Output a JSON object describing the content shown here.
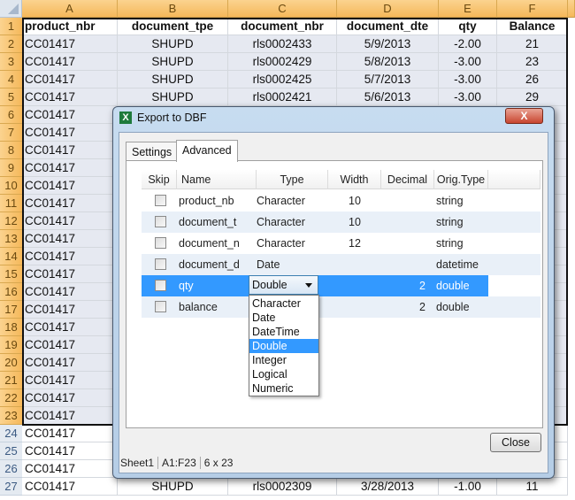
{
  "spreadsheet": {
    "columns": [
      "A",
      "B",
      "C",
      "D",
      "E",
      "F"
    ],
    "rows": [
      {
        "n": "1",
        "cells": [
          "product_nbr",
          "document_tpe",
          "document_nbr",
          "document_dte",
          "qty",
          "Balance"
        ]
      },
      {
        "n": "2",
        "cells": [
          "CC01417",
          "SHUPD",
          "rls0002433",
          "5/9/2013",
          "-2.00",
          "21"
        ]
      },
      {
        "n": "3",
        "cells": [
          "CC01417",
          "SHUPD",
          "rls0002429",
          "5/8/2013",
          "-3.00",
          "23"
        ]
      },
      {
        "n": "4",
        "cells": [
          "CC01417",
          "SHUPD",
          "rls0002425",
          "5/7/2013",
          "-3.00",
          "26"
        ]
      },
      {
        "n": "5",
        "cells": [
          "CC01417",
          "SHUPD",
          "rls0002421",
          "5/6/2013",
          "-3.00",
          "29"
        ]
      },
      {
        "n": "6",
        "cells": [
          "CC01417"
        ]
      },
      {
        "n": "7",
        "cells": [
          "CC01417"
        ]
      },
      {
        "n": "8",
        "cells": [
          "CC01417"
        ]
      },
      {
        "n": "9",
        "cells": [
          "CC01417"
        ]
      },
      {
        "n": "10",
        "cells": [
          "CC01417"
        ]
      },
      {
        "n": "11",
        "cells": [
          "CC01417"
        ]
      },
      {
        "n": "12",
        "cells": [
          "CC01417"
        ]
      },
      {
        "n": "13",
        "cells": [
          "CC01417"
        ]
      },
      {
        "n": "14",
        "cells": [
          "CC01417"
        ]
      },
      {
        "n": "15",
        "cells": [
          "CC01417"
        ]
      },
      {
        "n": "16",
        "cells": [
          "CC01417"
        ]
      },
      {
        "n": "17",
        "cells": [
          "CC01417"
        ]
      },
      {
        "n": "18",
        "cells": [
          "CC01417"
        ]
      },
      {
        "n": "19",
        "cells": [
          "CC01417"
        ]
      },
      {
        "n": "20",
        "cells": [
          "CC01417"
        ]
      },
      {
        "n": "21",
        "cells": [
          "CC01417"
        ]
      },
      {
        "n": "22",
        "cells": [
          "CC01417"
        ]
      },
      {
        "n": "23",
        "cells": [
          "CC01417"
        ]
      },
      {
        "n": "24",
        "cells": [
          "CC01417"
        ]
      },
      {
        "n": "25",
        "cells": [
          "CC01417"
        ]
      },
      {
        "n": "26",
        "cells": [
          "CC01417"
        ]
      },
      {
        "n": "27",
        "cells": [
          "CC01417",
          "SHUPD",
          "rls0002309",
          "3/28/2013",
          "-1.00",
          "11"
        ]
      }
    ]
  },
  "dialog": {
    "title": "Export to DBF",
    "close_glyph": "X",
    "app_icon": "X",
    "tabs": [
      {
        "label": "Settings",
        "active": false
      },
      {
        "label": "Advanced",
        "active": true
      }
    ],
    "grid": {
      "headers": [
        "Skip",
        "Name",
        "Type",
        "Width",
        "Decimal",
        "Orig.Type"
      ],
      "rows": [
        {
          "skip": false,
          "name": "product_nb",
          "type": "Character",
          "width": "10",
          "decimal": "",
          "orig": "string"
        },
        {
          "skip": false,
          "name": "document_t",
          "type": "Character",
          "width": "10",
          "decimal": "",
          "orig": "string"
        },
        {
          "skip": false,
          "name": "document_n",
          "type": "Character",
          "width": "12",
          "decimal": "",
          "orig": "string"
        },
        {
          "skip": false,
          "name": "document_d",
          "type": "Date",
          "width": "",
          "decimal": "",
          "orig": "datetime"
        },
        {
          "skip": false,
          "name": "qty",
          "type": "Double",
          "width": "",
          "decimal": "2",
          "orig": "double",
          "selected": true
        },
        {
          "skip": false,
          "name": "balance",
          "type": "",
          "width": "",
          "decimal": "2",
          "orig": "double"
        }
      ]
    },
    "type_dropdown": {
      "value": "Double",
      "options": [
        "Character",
        "Date",
        "DateTime",
        "Double",
        "Integer",
        "Logical",
        "Numeric"
      ],
      "highlighted": "Double"
    },
    "close_button": "Close",
    "status": [
      "Sheet1",
      "A1:F23",
      "6 x 23"
    ],
    "colors": {
      "selection": "#3399ff",
      "header_orange": "#f5b85a"
    }
  }
}
